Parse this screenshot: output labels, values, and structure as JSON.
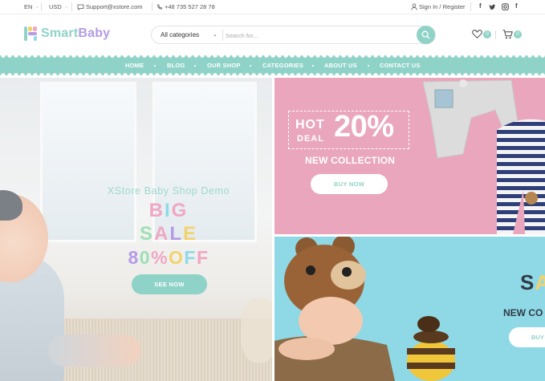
{
  "topbar": {
    "language": "EN",
    "currency": "USD",
    "email": "Support@xstore.com",
    "phone": "+48 735 527 28 78",
    "account": "Sign In / Register"
  },
  "header": {
    "brand_part1": "Smart",
    "brand_part2": "Baby",
    "search": {
      "category": "All categories",
      "placeholder": "Search for..."
    },
    "wishlist_count": "0",
    "cart_count": "0"
  },
  "nav": {
    "items": [
      "HOME",
      "BLOG",
      "OUR SHOP",
      "CATEGORIES",
      "ABOUT US",
      "CONTACT US"
    ]
  },
  "hero_main": {
    "subtitle": "XStore Baby Shop Demo",
    "line1": [
      "B",
      "I",
      "G"
    ],
    "line2": [
      "S",
      "A",
      "L",
      "E"
    ],
    "line3": [
      "8",
      "0",
      "%",
      " ",
      "O",
      "F",
      "F"
    ],
    "button": "SEE NOW"
  },
  "promo_top": {
    "hot": "HOT",
    "deal": "DEAL",
    "percent": "20%",
    "collection": "NEW COLLECTION",
    "button": "BUY NOW"
  },
  "promo_bottom": {
    "sale_letters": [
      "S",
      "A"
    ],
    "collection": "NEW CO",
    "button": "BUY"
  },
  "colors": {
    "accent": "#8fd3c8",
    "brand_purple": "#b49be6",
    "promo_pink": "#e9a6bd",
    "promo_blue": "#8fd9e6",
    "letter_pink": "#f0a7c4",
    "letter_blue": "#8ed9ea",
    "letter_yellow": "#f2d36b",
    "letter_green": "#9ee0b4",
    "letter_purple": "#b59be6"
  }
}
